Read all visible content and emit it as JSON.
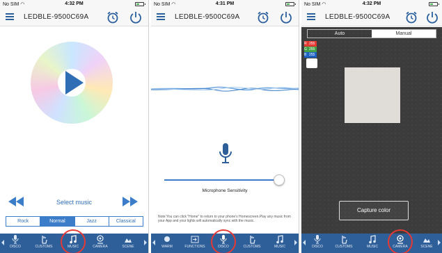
{
  "status": {
    "carrier": "No SIM",
    "wifi_icon": "wifi-icon",
    "times": [
      "4:32 PM",
      "4:31 PM",
      "4:32 PM"
    ]
  },
  "header": {
    "title": "LEDBLE-9500C69A"
  },
  "colors": {
    "accent": "#2f6db5",
    "nav_bg": "#2f5f98",
    "highlight_circle": "#e53935"
  },
  "music": {
    "select_label": "Select music",
    "genres": [
      {
        "label": "Rock",
        "active": false
      },
      {
        "label": "Normal",
        "active": true
      },
      {
        "label": "Jazz",
        "active": false
      },
      {
        "label": "Classical",
        "active": false
      }
    ],
    "nav": [
      {
        "label": "DISCO",
        "icon": "mic-icon"
      },
      {
        "label": "CUSTOMS",
        "icon": "hand-icon"
      },
      {
        "label": "MUSIC",
        "icon": "music-note-icon",
        "highlighted": true
      },
      {
        "label": "CAMERA",
        "icon": "camera-icon"
      },
      {
        "label": "SCENE",
        "icon": "scene-icon"
      }
    ]
  },
  "disco": {
    "mic_label": "Microphone Sensitivity",
    "sensitivity": 0.98,
    "note": "Note:You can click \"Home\" to return to your phone's Homescreen.Play any music from your App and your lights will automatically sync with the music.",
    "nav": [
      {
        "label": "WARM",
        "icon": "warm-icon"
      },
      {
        "label": "FUNCTIONS",
        "icon": "functions-icon"
      },
      {
        "label": "DISCO",
        "icon": "mic-icon",
        "highlighted": true
      },
      {
        "label": "CUSTOMS",
        "icon": "hand-icon"
      },
      {
        "label": "MUSIC",
        "icon": "music-note-icon"
      }
    ]
  },
  "camera": {
    "mode_tabs": [
      {
        "label": "Auto",
        "active": false
      },
      {
        "label": "Manual",
        "active": true
      }
    ],
    "rgb": [
      {
        "key": "R",
        "value": "255",
        "color": "#e53935"
      },
      {
        "key": "G",
        "value": "255",
        "color": "#43a047"
      },
      {
        "key": "B",
        "value": "255",
        "color": "#1e63c4"
      }
    ],
    "capture_label": "Capture color",
    "nav": [
      {
        "label": "DISCO",
        "icon": "mic-icon"
      },
      {
        "label": "CUSTOMS",
        "icon": "hand-icon"
      },
      {
        "label": "MUSIC",
        "icon": "music-note-icon"
      },
      {
        "label": "CAMERA",
        "icon": "camera-icon",
        "highlighted": true
      },
      {
        "label": "SCENE",
        "icon": "scene-icon"
      }
    ]
  }
}
